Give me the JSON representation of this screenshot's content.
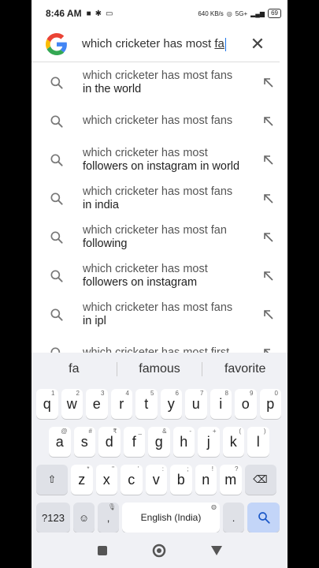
{
  "status_bar": {
    "time": "8:46 AM",
    "net_speed": "640 KB/s",
    "network": "5G+",
    "battery": "69"
  },
  "search": {
    "query_prefix": "which cricketer has most ",
    "query_typed": "fa"
  },
  "suggestions": [
    {
      "line1": "which cricketer has most fans",
      "line2": "in the world"
    },
    {
      "line1": "which cricketer has most fans",
      "line2": ""
    },
    {
      "line1": "which cricketer has most",
      "line2": "followers on instagram in world"
    },
    {
      "line1": "which cricketer has most fans",
      "line2": "in india"
    },
    {
      "line1": "which cricketer has most fan",
      "line2": "following"
    },
    {
      "line1": "which cricketer has most",
      "line2": "followers on instagram"
    },
    {
      "line1": "which cricketer has most fans",
      "line2": "in ipl"
    },
    {
      "line1": "which cricketer has most first",
      "line2": ""
    }
  ],
  "predictions": [
    "fa",
    "famous",
    "favorite"
  ],
  "keyboard": {
    "row1": [
      [
        "q",
        "1"
      ],
      [
        "w",
        "2"
      ],
      [
        "e",
        "3"
      ],
      [
        "r",
        "4"
      ],
      [
        "t",
        "5"
      ],
      [
        "y",
        "6"
      ],
      [
        "u",
        "7"
      ],
      [
        "i",
        "8"
      ],
      [
        "o",
        "9"
      ],
      [
        "p",
        "0"
      ]
    ],
    "row2": [
      [
        "a",
        "@"
      ],
      [
        "s",
        "#"
      ],
      [
        "d",
        "₹"
      ],
      [
        "f",
        "_"
      ],
      [
        "g",
        "&"
      ],
      [
        "h",
        "-"
      ],
      [
        "j",
        "+"
      ],
      [
        "k",
        "("
      ],
      [
        "l",
        ")"
      ]
    ],
    "row3": [
      [
        "z",
        "*"
      ],
      [
        "x",
        "\""
      ],
      [
        "c",
        "'"
      ],
      [
        "v",
        ":"
      ],
      [
        "b",
        ";"
      ],
      [
        "n",
        "!"
      ],
      [
        "m",
        "?"
      ]
    ],
    "symbols_label": "?123",
    "comma": ",",
    "space_label": "English (India)",
    "period": "."
  }
}
